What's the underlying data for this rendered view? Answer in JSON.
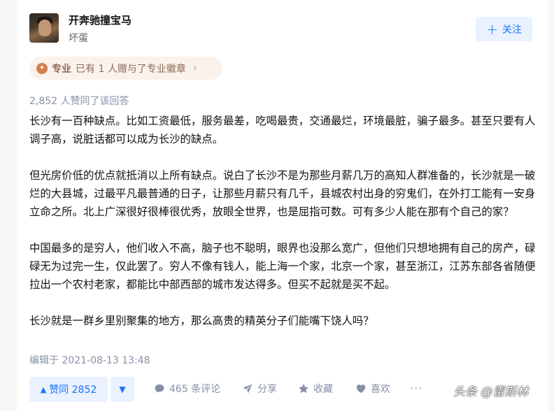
{
  "author": {
    "name": "开奔驰撞宝马",
    "bio": "坏蛋",
    "follow_label": "关注"
  },
  "badge": {
    "strong": "专业",
    "text": "已有 1 人赠与了专业徽章",
    "chevron": "›"
  },
  "vote_summary": "2,852 人赞同了该回答",
  "content": {
    "paragraphs": [
      "长沙有一百种缺点。比如工资最低，服务最差，吃喝最贵，交通最烂，环境最脏，骗子最多。甚至只要有人调子高，说脏话都可以成为长沙的缺点。",
      "但光房价低的优点就抵消以上所有缺点。说白了长沙不是为那些月薪几万的高知人群准备的，长沙就是一破烂的大县城，过最平凡最普通的日子，让那些月薪只有几千，县城农村出身的穷鬼们，在外打工能有一安身立命之所。北上广深很好很棒很优秀，放眼全世界，也是屈指可数。可有多少人能在那有个自己的家？",
      "中国最多的是穷人，他们收入不高，脑子也不聪明，眼界也没那么宽广，但他们只想地拥有自己的房产，碌碌无为过完一生，仅此罢了。穷人不像有钱人，能上海一个家，北京一个家，甚至浙江，江苏东部各省随便拉出一个农村老家，都能比中部西部的城市发达得多。但买不起就是买不起。",
      "长沙就是一群乡里别聚集的地方，那么高贵的精英分子们能嘴下饶人吗？"
    ]
  },
  "edited": "编辑于 2021-08-13 13:48",
  "actions": {
    "upvote_label": "赞同 2852",
    "comments_label": "465 条评论",
    "share_label": "分享",
    "favorite_label": "收藏",
    "like_label": "喜欢",
    "more_label": "···"
  },
  "watermark": "头条 @雷斯林",
  "colors": {
    "accent": "#1772f6",
    "accent_bg": "#eaf2ff",
    "meta": "#8590a6",
    "badge_bg": "#fbf2ec",
    "badge_text": "#8c6a55"
  }
}
